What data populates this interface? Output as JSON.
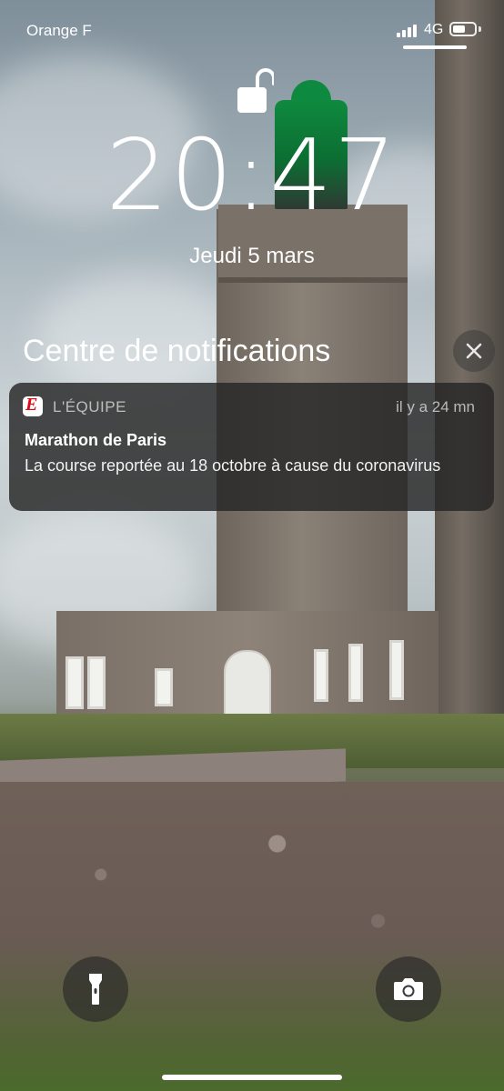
{
  "status_bar": {
    "carrier": "Orange F",
    "network": "4G",
    "signal_bars": 4,
    "battery_level": 0.6
  },
  "lock_screen": {
    "time": "20:47",
    "date": "Jeudi 5 mars",
    "lock_state": "unlocked"
  },
  "notification_center": {
    "title": "Centre de notifications"
  },
  "notification": {
    "app_name": "L'ÉQUIPE",
    "app_icon_letter": "E",
    "time_ago": "il y a 24 mn",
    "title": "Marathon de Paris",
    "body": "La course reportée au 18 octobre à cause du coronavirus"
  },
  "quick_actions": {
    "left": "flashlight-icon",
    "right": "camera-icon"
  },
  "colors": {
    "notification_bg": "#262626",
    "app_brand": "#e30613"
  }
}
